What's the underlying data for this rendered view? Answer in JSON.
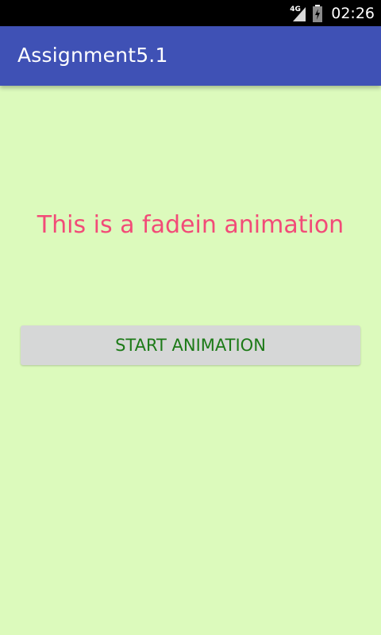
{
  "status_bar": {
    "network_type": "4G",
    "time": "02:26",
    "signal_icon": "signal-icon",
    "battery_icon": "battery-icon"
  },
  "app_bar": {
    "title": "Assignment5.1",
    "color": "#3f51b5"
  },
  "main": {
    "headline": "This is a fadein animation",
    "headline_color": "#f24b78",
    "background_color": "#dcfabc",
    "button_label": "START ANIMATION",
    "button_text_color": "#1c7a17"
  }
}
